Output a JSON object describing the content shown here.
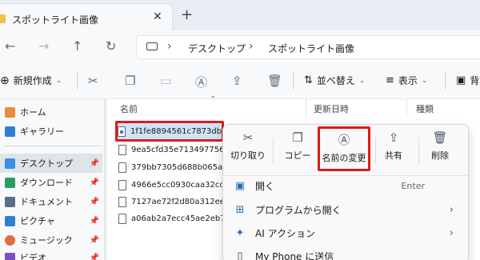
{
  "tab": {
    "title": "スポットライト画像",
    "close": "✕",
    "new": "+"
  },
  "breadcrumbs": [
    "デスクトップ",
    "スポットライト画像"
  ],
  "toolbar": {
    "new_label": "新規作成",
    "sort_label": "並べ替え",
    "view_label": "表示",
    "partial_label": "背"
  },
  "sidebar": {
    "items": [
      {
        "label": "ホーム",
        "icon": "home-icon"
      },
      {
        "label": "ギャラリー",
        "icon": "gallery-icon"
      },
      {
        "label": "デスクトップ",
        "icon": "desktop-icon"
      },
      {
        "label": "ダウンロード",
        "icon": "download-icon"
      },
      {
        "label": "ドキュメント",
        "icon": "document-icon"
      },
      {
        "label": "ピクチャ",
        "icon": "picture-icon"
      },
      {
        "label": "ミュージック",
        "icon": "music-icon"
      },
      {
        "label": "ビデオ",
        "icon": "video-icon"
      }
    ]
  },
  "columns": {
    "name": "名前",
    "date": "更新日時",
    "type": "種類"
  },
  "files": [
    "1f1fe8894561c7873dbb",
    "9ea5cfd35e713497756c",
    "379bb7305d688b065af",
    "4966e5cc0930caa32cc",
    "7127ae72f2d80a312ee",
    "a06ab2a7ecc45ae2eb7"
  ],
  "context_menu": {
    "actions": [
      {
        "label": "切り取り",
        "icon": "cut-icon"
      },
      {
        "label": "コピー",
        "icon": "copy-icon"
      },
      {
        "label": "名前の変更",
        "icon": "rename-icon"
      },
      {
        "label": "共有",
        "icon": "share-icon"
      },
      {
        "label": "削除",
        "icon": "delete-icon"
      }
    ],
    "items": [
      {
        "label": "開く",
        "shortcut": "Enter",
        "icon": "open-icon"
      },
      {
        "label": "プログラムから開く",
        "icon": "open-with-icon"
      },
      {
        "label": "AI アクション",
        "icon": "ai-sparkle-icon"
      },
      {
        "label": "My Phone に送信",
        "icon": "phone-icon"
      }
    ]
  },
  "colors": {
    "accent": "#2d6cb5",
    "highlight": "#e0191b",
    "folder": "#f2c14b"
  }
}
